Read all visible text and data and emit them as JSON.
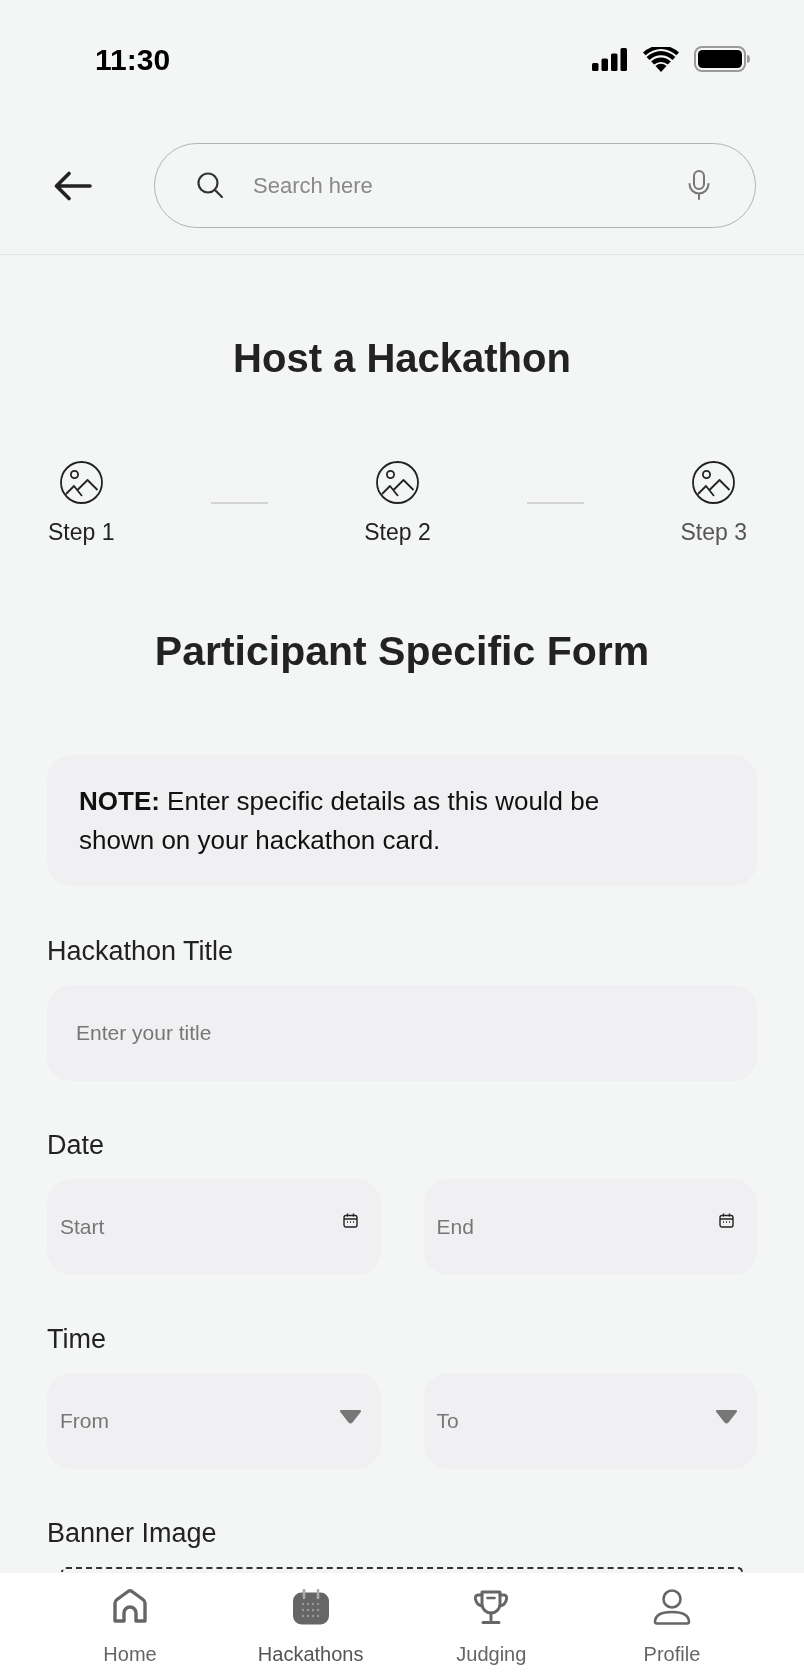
{
  "status_bar": {
    "time": "11:30"
  },
  "header": {
    "search": {
      "placeholder": "Search here"
    }
  },
  "title": "Host a Hackathon",
  "steps": [
    {
      "label": "Step 1",
      "active": true
    },
    {
      "label": "Step 2",
      "active": true
    },
    {
      "label": "Step 3",
      "active": false
    }
  ],
  "form": {
    "heading": "Participant Specific Form",
    "note": "**NOTE:** Enter specific details as this would be shown on your hackathon card.",
    "sections": [
      {
        "label": "Hackathon Title",
        "inputs": [
          {
            "kind": "text",
            "placeholder": "Enter your title"
          }
        ]
      },
      {
        "label": "Date",
        "inputs": [
          {
            "kind": "date",
            "placeholder": "Start"
          },
          {
            "kind": "date",
            "placeholder": "End"
          }
        ]
      },
      {
        "label": "Time",
        "inputs": [
          {
            "kind": "select",
            "placeholder": "From"
          },
          {
            "kind": "select",
            "placeholder": "To"
          }
        ]
      },
      {
        "label": "Banner Image",
        "inputs": [
          {
            "kind": "upload"
          }
        ]
      }
    ]
  },
  "nav": {
    "items": [
      {
        "label": "Home",
        "selected": false
      },
      {
        "label": "Hackathons",
        "selected": true
      },
      {
        "label": "Judging",
        "selected": false
      },
      {
        "label": "Profile",
        "selected": false
      }
    ]
  }
}
